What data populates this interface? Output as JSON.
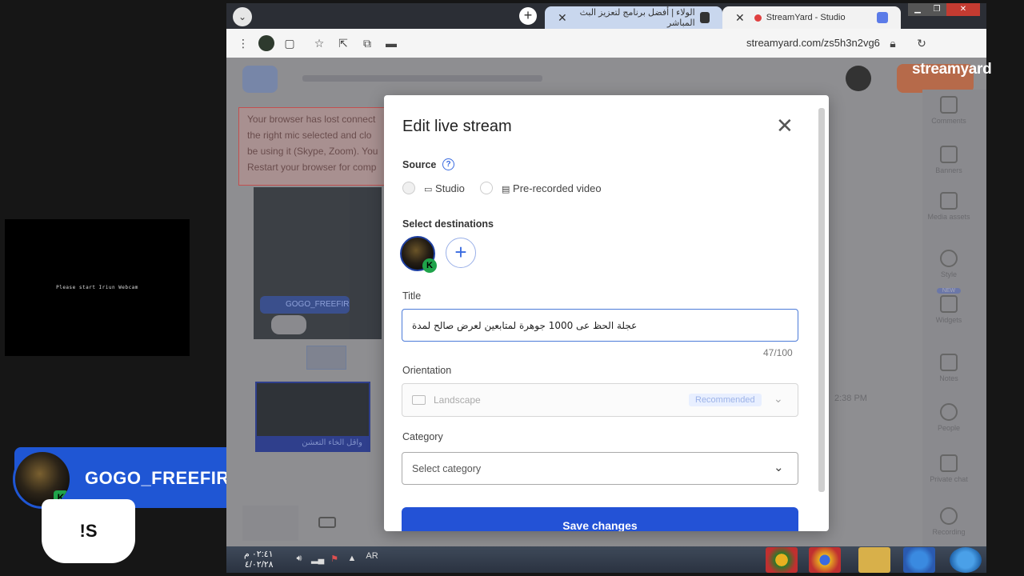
{
  "overlay": {
    "webcam_message": "Please start Iriun Webcam",
    "banner_name": "GOGO_FREEFIRE",
    "message_text": "!S",
    "badge_letter": "K",
    "brand_logo": "streamyard"
  },
  "browser": {
    "tabs": [
      {
        "title": "StreamYard - Studio",
        "active": true
      },
      {
        "title": "الولاء | أفضل برنامج لتعزيز البث المباشر",
        "active": false
      }
    ],
    "url": "streamyard.com/zs5h3n2vg6",
    "window_controls": [
      "minimize",
      "maximize",
      "close"
    ]
  },
  "background_page": {
    "alert_lines": [
      "Your browser has lost connect",
      "the right mic selected and clo",
      "be using it (Skype, Zoom). You",
      "Restart your browser for comp"
    ],
    "participant_name": "GOGO_FREEFIRE",
    "rail_items": [
      "Comments",
      "Banners",
      "Media assets",
      "Style",
      "Widgets",
      "Notes",
      "People",
      "Private chat",
      "Recording"
    ],
    "rail_new_badge": "NEW",
    "scene_label": "واقل الخاء التعشن",
    "time_text": "2:38 PM"
  },
  "modal": {
    "title": "Edit live stream",
    "source_label": "Source",
    "source_options": [
      "Studio",
      "Pre-recorded video"
    ],
    "destinations_label": "Select destinations",
    "title_label": "Title",
    "title_value": "عجلة الحظ عى 1000 جوهرة لمتابعين لعرض صالح لمدة",
    "char_count": "47/100",
    "orientation_label": "Orientation",
    "orientation_value": "Landscape",
    "orientation_badge": "Recommended",
    "category_label": "Category",
    "category_placeholder": "Select category",
    "save_label": "Save changes"
  },
  "taskbar": {
    "time": "٠٢:٤١ م",
    "date": "٤/٠٢/٢٨",
    "language": "AR"
  },
  "colors": {
    "accent": "#2352d6",
    "banner": "#1f56d4",
    "badge_green": "#1fa34a"
  }
}
